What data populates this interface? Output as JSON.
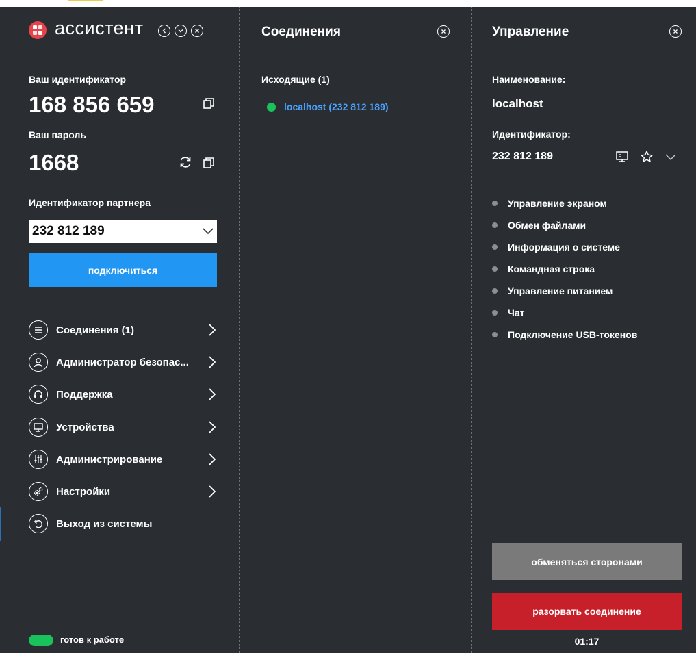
{
  "colors": {
    "background": "#2a2e33",
    "accent_blue": "#2196f3",
    "link_blue": "#4aa3ff",
    "status_green": "#19c25a",
    "swap_gray": "#7a7a7a",
    "disconnect_red": "#c8202a",
    "logo_red": "#e8424a"
  },
  "app": {
    "logo_text": "ассистент",
    "window_controls": [
      "back-icon",
      "minimize-icon",
      "close-icon"
    ]
  },
  "left": {
    "id_label": "Ваш идентификатор",
    "id_value": "168 856 659",
    "password_label": "Ваш пароль",
    "password_value": "1668",
    "partner_label": "Идентификатор партнера",
    "partner_value": "232 812 189",
    "connect_button": "подключиться",
    "nav": [
      {
        "label": "Соединения (1)",
        "icon": "list-icon"
      },
      {
        "label": "Администратор безопас...",
        "icon": "user-icon"
      },
      {
        "label": "Поддержка",
        "icon": "headset-icon"
      },
      {
        "label": "Устройства",
        "icon": "monitor-icon"
      },
      {
        "label": "Администрирование",
        "icon": "sliders-icon"
      },
      {
        "label": "Настройки",
        "icon": "gears-icon"
      },
      {
        "label": "Выход из системы",
        "icon": "logout-icon"
      }
    ],
    "status_text": "готов к работе"
  },
  "middle": {
    "title": "Соединения",
    "outgoing_header": "Исходящие (1)",
    "connection": "localhost (232 812 189)"
  },
  "right": {
    "title": "Управление",
    "name_label": "Наименование:",
    "name_value": "localhost",
    "id_label": "Идентификатор:",
    "id_value": "232 812 189",
    "features": [
      "Управление экраном",
      "Обмен файлами",
      "Информация о системе",
      "Командная строка",
      "Управление питанием",
      "Чат",
      "Подключение USB-токенов"
    ],
    "swap_button": "обменяться сторонами",
    "disconnect_button": "разорвать соединение",
    "timer": "01:17"
  }
}
